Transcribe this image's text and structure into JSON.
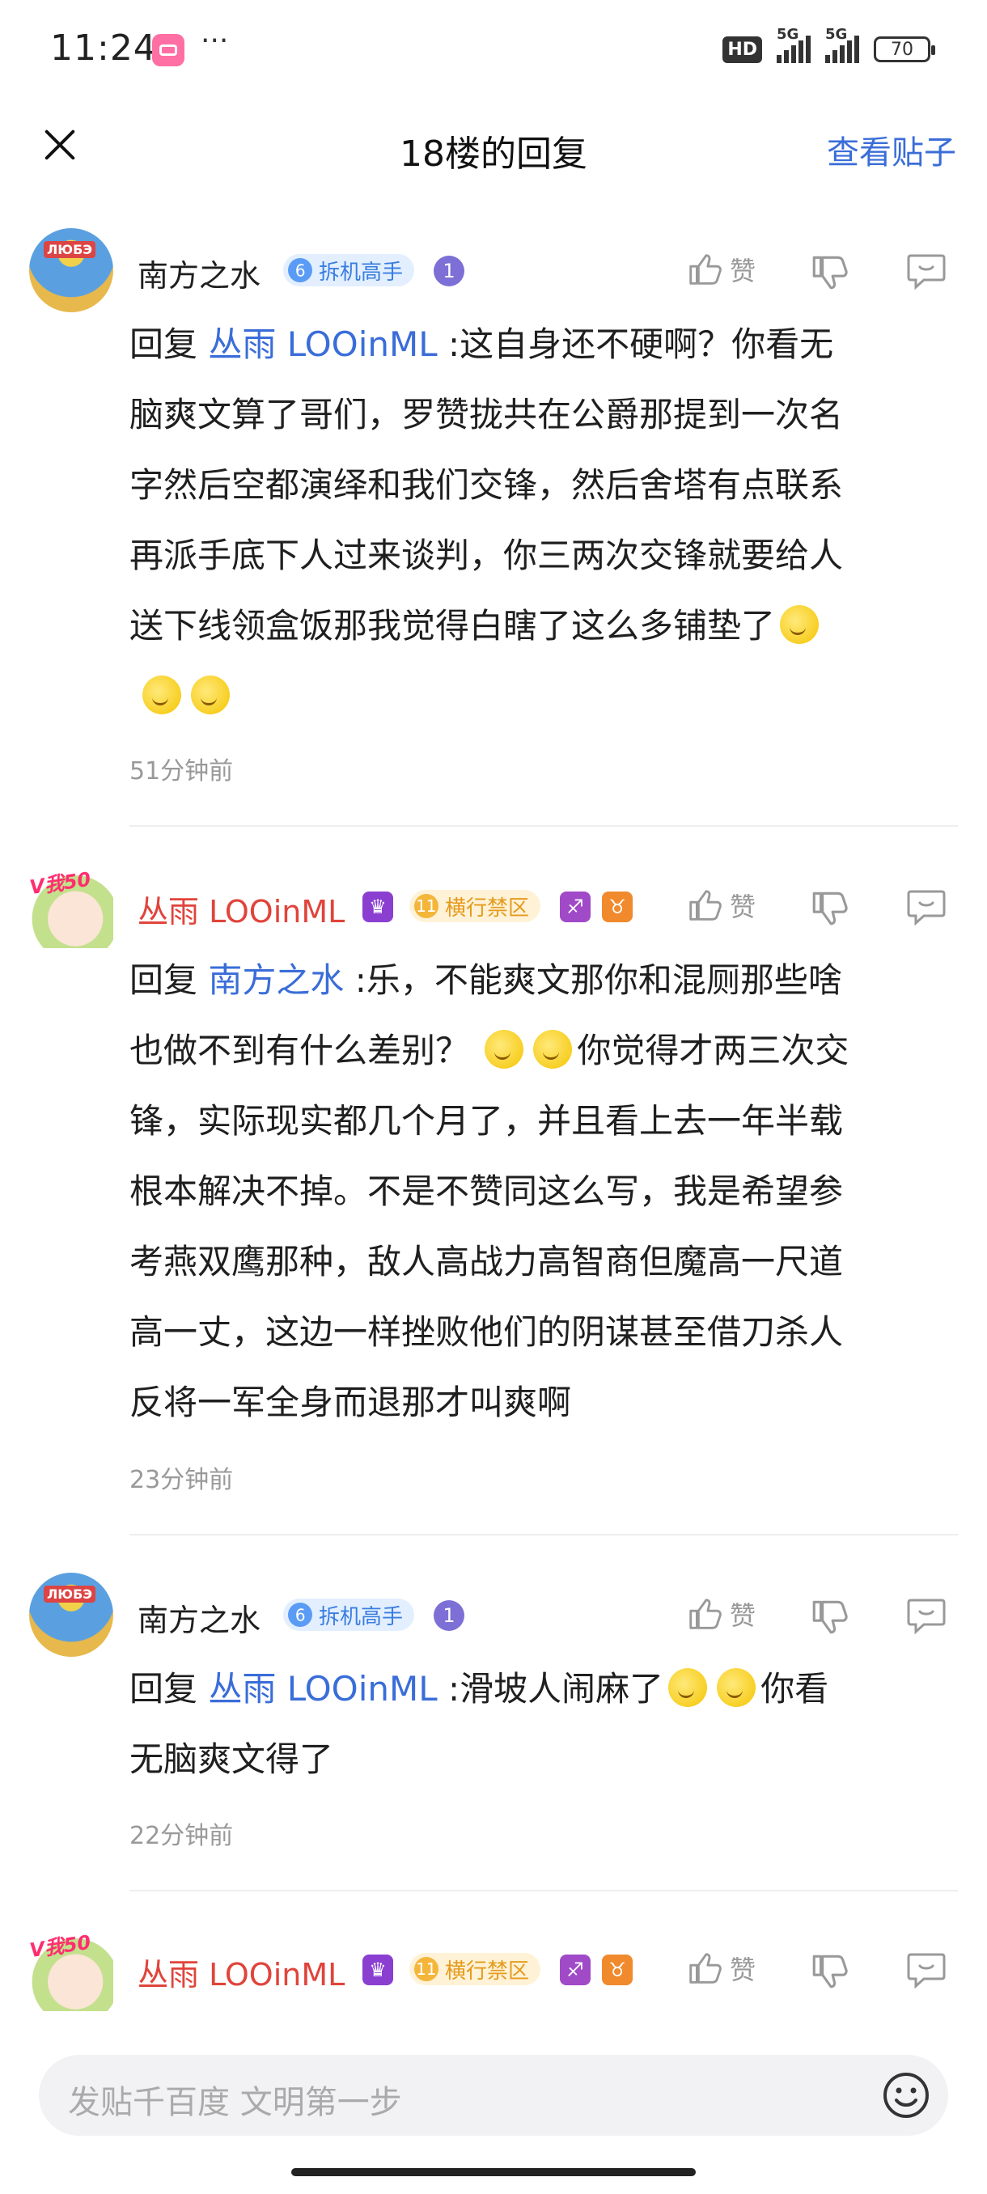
{
  "status_bar": {
    "time": "11:24",
    "more": "···",
    "hd": "HD",
    "net1": "5G",
    "net2": "5G",
    "battery": "70"
  },
  "nav": {
    "title": "18楼的回复",
    "view_post": "查看贴子"
  },
  "comments": [
    {
      "user": "南方之水",
      "avatar_text": "ЛЮБЭ",
      "level": "6",
      "badge": "拆机高手",
      "like_label": "赞",
      "reply_prefix": "回复",
      "mention": "丛雨 LOOinML",
      "line1_text": " :这自身还不硬啊？你看无",
      "line2": "脑爽文算了哥们，罗赞拢共在公爵那提到一次名",
      "line3": "字然后空都演绎和我们交锋，然后舍塔有点联系",
      "line4": "再派手底下人过来谈判，你三两次交锋就要给人",
      "line5": "送下线领盒饭那我觉得白瞎了这么多铺垫了",
      "time": "51分钟前"
    },
    {
      "user": "丛雨 LOOinML",
      "avatar_text": "V我50",
      "level": "11",
      "badge": "横行禁区",
      "like_label": "赞",
      "reply_prefix": "回复",
      "mention": "南方之水",
      "line1_text": " :乐，不能爽文那你和混厕那些啥",
      "line2_text": "也做不到有什么差别？",
      "line2_after": "你觉得才两三次交",
      "line3": "锋，实际现实都几个月了，并且看上去一年半载",
      "line4": "根本解决不掉。不是不赞同这么写，我是希望参",
      "line5": "考燕双鹰那种，敌人高战力高智商但魔高一尺道",
      "line6": "高一丈，这边一样挫败他们的阴谋甚至借刀杀人",
      "line7": "反将一军全身而退那才叫爽啊",
      "time": "23分钟前"
    },
    {
      "user": "南方之水",
      "avatar_text": "ЛЮБЭ",
      "level": "6",
      "badge": "拆机高手",
      "like_label": "赞",
      "reply_prefix": "回复",
      "mention": "丛雨 LOOinML",
      "line1_text": " :滑坡人闹麻了",
      "line1_after": "你看",
      "line2": "无脑爽文得了",
      "time": "22分钟前"
    },
    {
      "user": "丛雨 LOOinML",
      "avatar_text": "V我50",
      "level": "11",
      "badge": "横行禁区",
      "like_label": "赞"
    }
  ],
  "input": {
    "placeholder": "发贴千百度 文明第一步"
  },
  "colors": {
    "link": "#3a6dd8",
    "username_vip": "#e0443b",
    "muted": "#999999"
  }
}
